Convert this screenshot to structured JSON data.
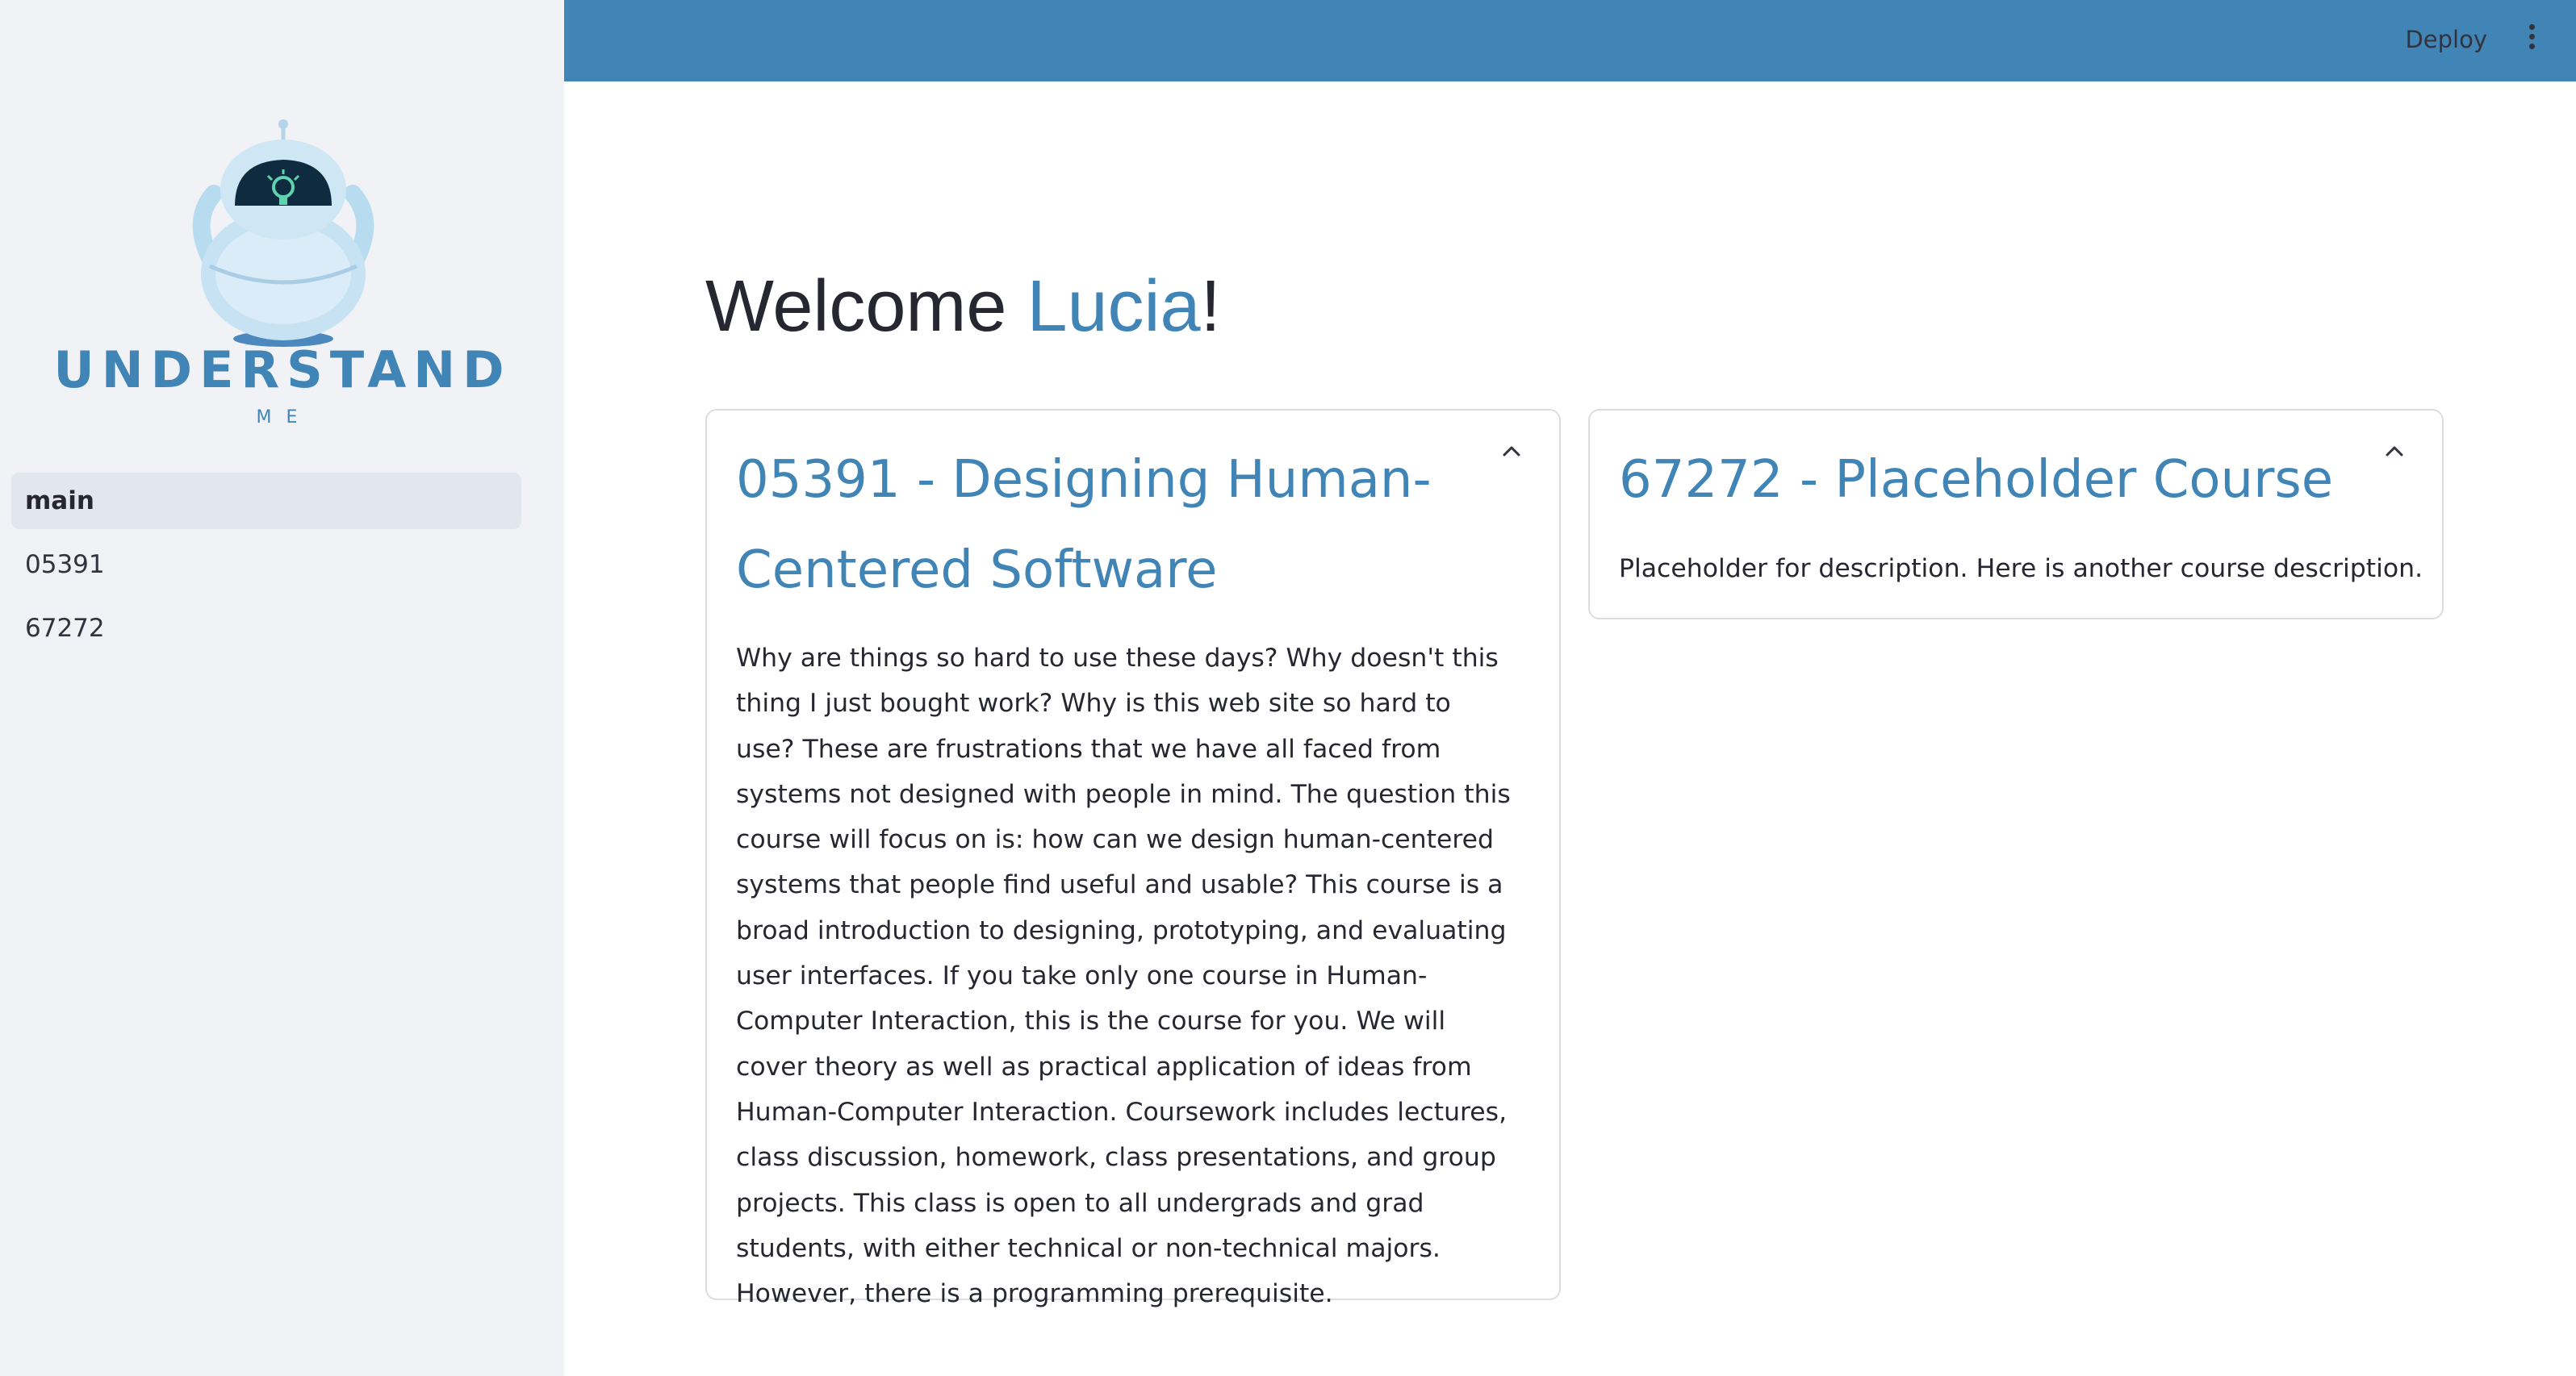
{
  "sidebar": {
    "logo": {
      "text": "UNDERSTAND",
      "subtext": "ME"
    },
    "items": [
      {
        "label": "main",
        "active": true
      },
      {
        "label": "05391",
        "active": false
      },
      {
        "label": "67272",
        "active": false
      }
    ]
  },
  "header": {
    "deploy_label": "Deploy",
    "menu_icon": "vertical-dots-icon",
    "bg_color": "#4185b6"
  },
  "main": {
    "welcome_prefix": "Welcome ",
    "user_name": "Lucia",
    "welcome_suffix": "!",
    "courses": [
      {
        "title": "05391 - Designing Human-Centered Software",
        "description": "Why are things so hard to use these days? Why doesn't this thing I just bought work? Why is this web site so hard to use? These are frustrations that we have all faced from systems not designed with people in mind. The question this course will focus on is: how can we design human-centered systems that people find useful and usable? This course is a broad introduction to designing, prototyping, and evaluating user interfaces. If you take only one course in Human-Computer Interaction, this is the course for you. We will cover theory as well as practical application of ideas from Human-Computer Interaction. Coursework includes lectures, class discussion, homework, class presentations, and group projects. This class is open to all undergrads and grad students, with either technical or non-technical majors. However, there is a programming prerequisite.",
        "expanded": true
      },
      {
        "title": "67272 - Placeholder Course",
        "description": "Placeholder for description. Here is another course description.",
        "expanded": true
      }
    ]
  },
  "colors": {
    "accent": "#4185b6",
    "sidebar_bg": "#f0f2f6",
    "text": "#262730"
  }
}
